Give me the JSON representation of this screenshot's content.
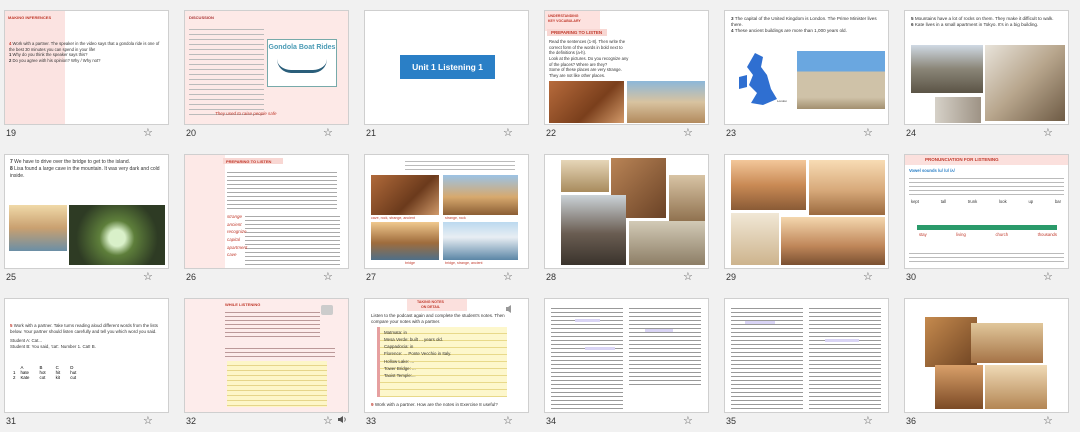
{
  "slides": [
    {
      "num": "19",
      "head": "MAKING INFERENCES",
      "lines": [
        "Work with a partner. The speaker in the video says that a gondola ride is one of the best 30 minutes you can spend in your life!",
        "Why do you think the speaker says this?",
        "Do you agree with his opinion? Why / Why not?"
      ],
      "line_nums": [
        "4",
        "1",
        "2"
      ]
    },
    {
      "num": "20",
      "head": "DISCUSSION",
      "gondola_title": "Gondola Boat Rides",
      "handnote": "They used to raise people safe"
    },
    {
      "num": "21",
      "title": "Unit 1   Listening 1"
    },
    {
      "num": "22",
      "head1": "UNDERSTANDING",
      "head2": "KEY VOCABULARY",
      "bar": "PREPARING TO LISTEN",
      "lines": [
        "Read the sentences (1-8). Then write the correct form of the words in bold next to the definitions (a-h).",
        "Look at the pictures. Do you recognize any of the places? Where are they?",
        "Some of these places are very strange. They are not like other places."
      ],
      "green": "recognize",
      "red": "strange"
    },
    {
      "num": "23",
      "lines": [
        "The capital of the United Kingdom is London. The Prime Minister lives there.",
        "These ancient buildings are more than 1,000 years old."
      ],
      "line_nums": [
        "3",
        "4"
      ],
      "green": [
        "capital",
        "ancient"
      ],
      "map_label": "London"
    },
    {
      "num": "24",
      "lines": [
        "Mountains have a lot of rocks on them. They make it difficult to walk.",
        "Kate lives in a small apartment in Tokyo. It's in a big building."
      ],
      "line_nums": [
        "5",
        "6"
      ],
      "green": [
        "rocks",
        "apartment"
      ]
    },
    {
      "num": "25",
      "lines": [
        "We have to drive over the bridge to get to the island.",
        "Lisa found a large cave in the mountain. It was very dark and cold inside."
      ],
      "line_nums": [
        "7",
        "8"
      ],
      "green": [
        "bridge",
        "cave"
      ]
    },
    {
      "num": "26",
      "bar": "PREPARING TO LISTEN",
      "handwords": [
        "strange",
        "ancient",
        "recognize",
        "capital",
        "apartment",
        "cave"
      ]
    },
    {
      "num": "27",
      "captions": [
        "cave, rock, strange, ancient",
        "strange, rock",
        "strange, ancient, bridge",
        "bridge",
        "bridge, strange, ancient"
      ]
    },
    {
      "num": "28"
    },
    {
      "num": "29"
    },
    {
      "num": "30",
      "bar": "PRONUNCIATION FOR LISTENING",
      "sub": "Vowel sounds /u/ /ʊ/ /ʌ/",
      "table": [
        "kept",
        "tall",
        "trunk",
        "look",
        "up",
        "bar"
      ],
      "bottom": [
        "stay",
        "living",
        "church",
        "thousands",
        "smaller"
      ]
    },
    {
      "num": "31",
      "lines": [
        "Work with a partner. Take turns reading aloud different words from the lists below. Your partner should listen carefully and tell you which word you said.",
        "Student A: Cat...",
        "Student B: You said, 'cat'. Number 1. Cat! B."
      ],
      "line_nums": [
        "5"
      ],
      "cols": [
        "A",
        "B",
        "C",
        "D"
      ],
      "rows": [
        [
          "1",
          "hate",
          "hot",
          "hit",
          "hut"
        ],
        [
          "2",
          "Kate",
          "cot",
          "kit",
          "cut"
        ]
      ]
    },
    {
      "num": "32",
      "head": "WHILE LISTENING"
    },
    {
      "num": "33",
      "head1": "TAKING NOTES",
      "head2": "ON DETAIL",
      "intro": "Listen to the podcast again and complete the student's notes. Then compare your notes with a partner.",
      "notes": [
        "Matmata: in",
        "Mesa Verde: built ... years old.",
        "Cappadocia: in",
        "Florence: ... Ponte Vecchio in Italy.",
        "Hollow Lake: ...",
        "Tower Bridge: ...",
        "Taoist Temple:..."
      ],
      "footer": "Work with a partner. How are the notes in Exercise 8 useful?",
      "footer_num": "9"
    },
    {
      "num": "34"
    },
    {
      "num": "35"
    },
    {
      "num": "36"
    }
  ]
}
